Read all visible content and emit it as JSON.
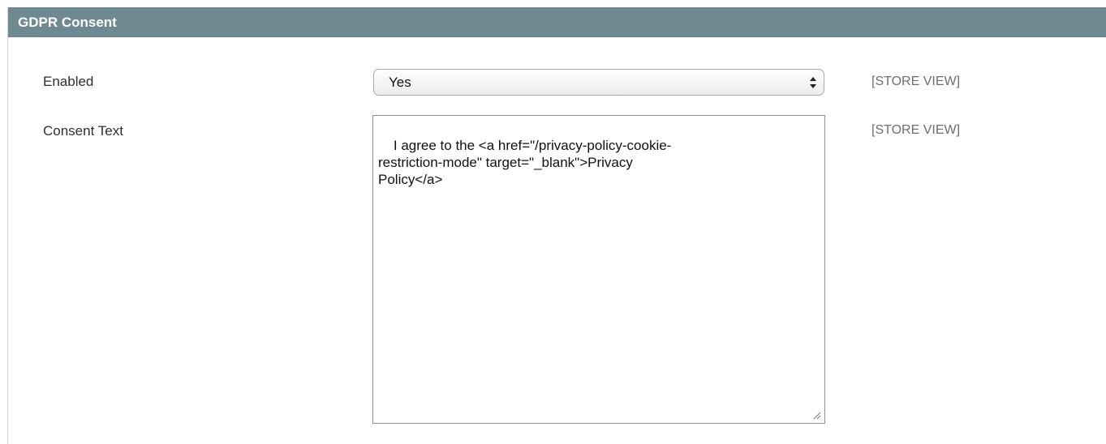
{
  "section": {
    "title": "GDPR Consent"
  },
  "fields": {
    "enabled": {
      "label": "Enabled",
      "value": "Yes",
      "scope": "[STORE VIEW]"
    },
    "consent_text": {
      "label": "Consent Text",
      "value": "I agree to the <a href=\"/privacy-policy-cookie-\nrestriction-mode\" target=\"_blank\">Privacy\nPolicy</a>",
      "scope": "[STORE VIEW]"
    }
  },
  "icons": {
    "select_arrows": "select-arrows-icon",
    "resize_grip": "resize-grip-icon"
  },
  "colors": {
    "header_bg": "#6f8992",
    "header_text": "#ffffff",
    "scope_text": "#6d6d6d"
  }
}
